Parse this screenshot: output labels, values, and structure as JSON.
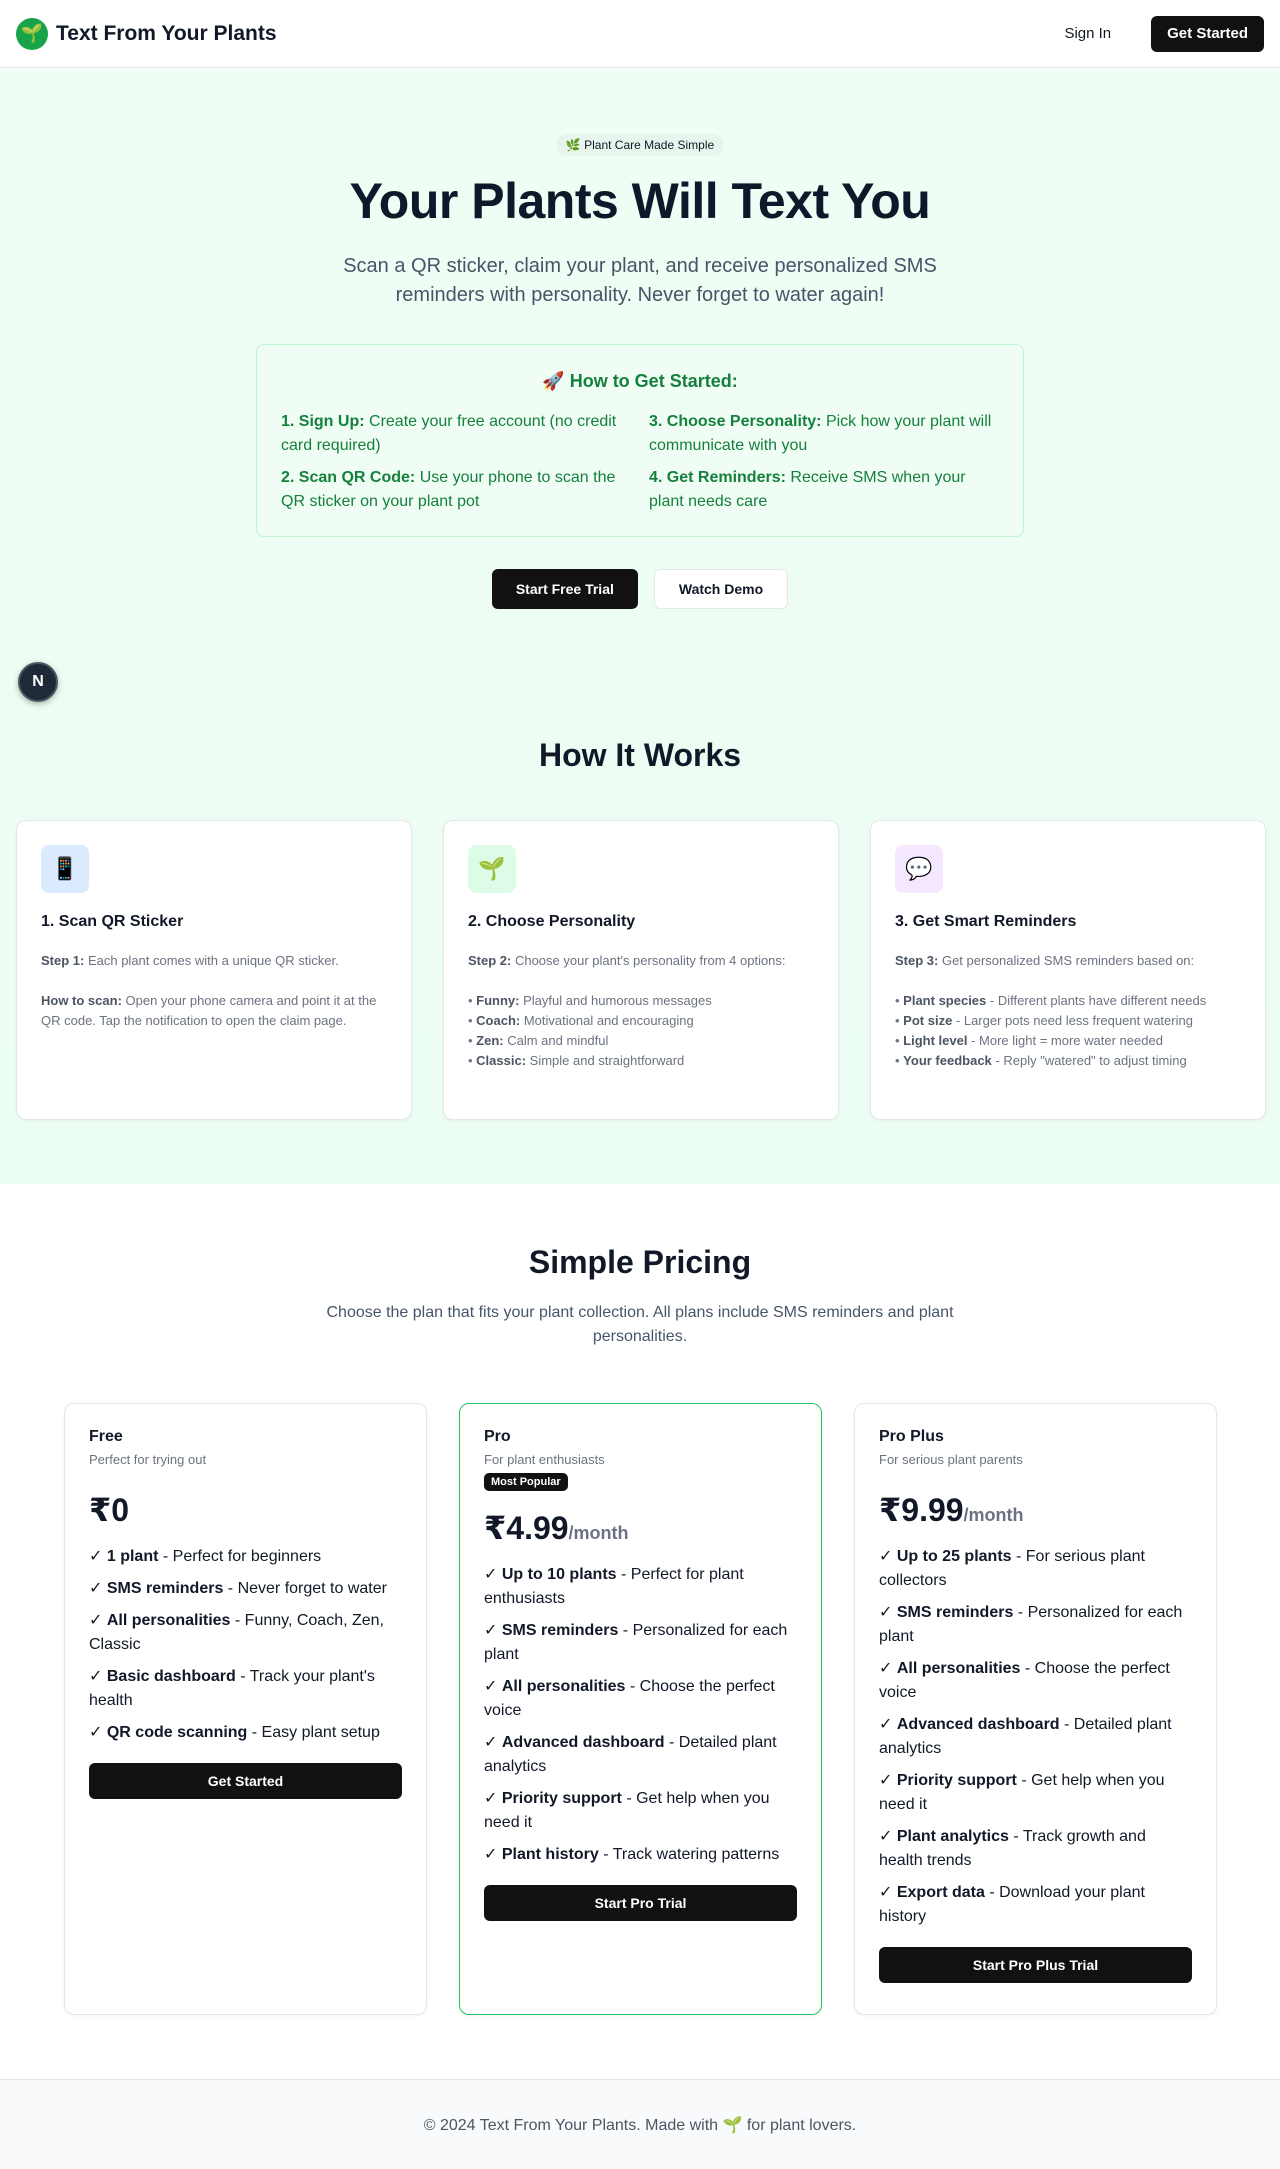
{
  "header": {
    "brand": "Text From Your Plants",
    "logo_icon": "🌱",
    "sign_in": "Sign In",
    "get_started": "Get Started"
  },
  "hero": {
    "pill": "🌿 Plant Care Made Simple",
    "title": "Your Plants Will Text You",
    "subtitle": "Scan a QR sticker, claim your plant, and receive personalized SMS reminders with personality. Never forget to water again!",
    "guide_title": "🚀 How to Get Started:",
    "steps": [
      {
        "label": "1. Sign Up:",
        "text": " Create your free account (no credit card required)"
      },
      {
        "label": "3. Choose Personality:",
        "text": " Pick how your plant will communicate with you"
      },
      {
        "label": "2. Scan QR Code:",
        "text": " Use your phone to scan the QR sticker on your plant pot"
      },
      {
        "label": "4. Get Reminders:",
        "text": " Receive SMS when your plant needs care"
      }
    ],
    "start_trial": "Start Free Trial",
    "watch_demo": "Watch Demo",
    "n_badge": "N"
  },
  "how": {
    "title": "How It Works",
    "cards": [
      {
        "icon": "📱",
        "title": "1. Scan QR Sticker",
        "p1_label": "Step 1:",
        "p1_text": " Each plant comes with a unique QR sticker.",
        "p2_label": "How to scan:",
        "p2_text": " Open your phone camera and point it at the QR code. Tap the notification to open the claim page."
      },
      {
        "icon": "🌱",
        "title": "2. Choose Personality",
        "p1_label": "Step 2:",
        "p1_text": " Choose your plant's personality from 4 options:",
        "bullets": [
          {
            "label": "Funny:",
            "text": " Playful and humorous messages"
          },
          {
            "label": "Coach:",
            "text": " Motivational and encouraging"
          },
          {
            "label": "Zen:",
            "text": " Calm and mindful"
          },
          {
            "label": "Classic:",
            "text": " Simple and straightforward"
          }
        ]
      },
      {
        "icon": "💬",
        "title": "3. Get Smart Reminders",
        "p1_label": "Step 3:",
        "p1_text": " Get personalized SMS reminders based on:",
        "bullets": [
          {
            "label": "Plant species",
            "text": " - Different plants have different needs"
          },
          {
            "label": "Pot size",
            "text": " - Larger pots need less frequent watering"
          },
          {
            "label": "Light level",
            "text": " - More light = more water needed"
          },
          {
            "label": "Your feedback",
            "text": " - Reply \"watered\" to adjust timing"
          }
        ]
      }
    ]
  },
  "pricing": {
    "title": "Simple Pricing",
    "subtitle": "Choose the plan that fits your plant collection. All plans include SMS reminders and plant personalities.",
    "plans": [
      {
        "name": "Free",
        "desc": "Perfect for trying out",
        "price": "₹0",
        "per": "",
        "features": [
          {
            "label": "1 plant",
            "text": " - Perfect for beginners"
          },
          {
            "label": "SMS reminders",
            "text": " - Never forget to water"
          },
          {
            "label": "All personalities",
            "text": " - Funny, Coach, Zen, Classic"
          },
          {
            "label": "Basic dashboard",
            "text": " - Track your plant's health"
          },
          {
            "label": "QR code scanning",
            "text": " - Easy plant setup"
          }
        ],
        "button": "Get Started"
      },
      {
        "name": "Pro",
        "desc": "For plant enthusiasts",
        "badge": "Most Popular",
        "price": "₹4.99",
        "per": "/month",
        "features": [
          {
            "label": "Up to 10 plants",
            "text": " - Perfect for plant enthusiasts"
          },
          {
            "label": "SMS reminders",
            "text": " - Personalized for each plant"
          },
          {
            "label": "All personalities",
            "text": " - Choose the perfect voice"
          },
          {
            "label": "Advanced dashboard",
            "text": " - Detailed plant analytics"
          },
          {
            "label": "Priority support",
            "text": " - Get help when you need it"
          },
          {
            "label": "Plant history",
            "text": " - Track watering patterns"
          }
        ],
        "button": "Start Pro Trial"
      },
      {
        "name": "Pro Plus",
        "desc": "For serious plant parents",
        "price": "₹9.99",
        "per": "/month",
        "features": [
          {
            "label": "Up to 25 plants",
            "text": " - For serious plant collectors"
          },
          {
            "label": "SMS reminders",
            "text": " - Personalized for each plant"
          },
          {
            "label": "All personalities",
            "text": " - Choose the perfect voice"
          },
          {
            "label": "Advanced dashboard",
            "text": " - Detailed plant analytics"
          },
          {
            "label": "Priority support",
            "text": " - Get help when you need it"
          },
          {
            "label": "Plant analytics",
            "text": " - Track growth and health trends"
          },
          {
            "label": "Export data",
            "text": " - Download your plant history"
          }
        ],
        "button": "Start Pro Plus Trial"
      }
    ]
  },
  "footer": {
    "text": "© 2024 Text From Your Plants. Made with 🌱 for plant lovers."
  },
  "colors": {
    "accent_green": "#15803d",
    "hero_bg": "#f0fdf4",
    "dark_button": "#111111",
    "featured_border": "#22c55e"
  }
}
